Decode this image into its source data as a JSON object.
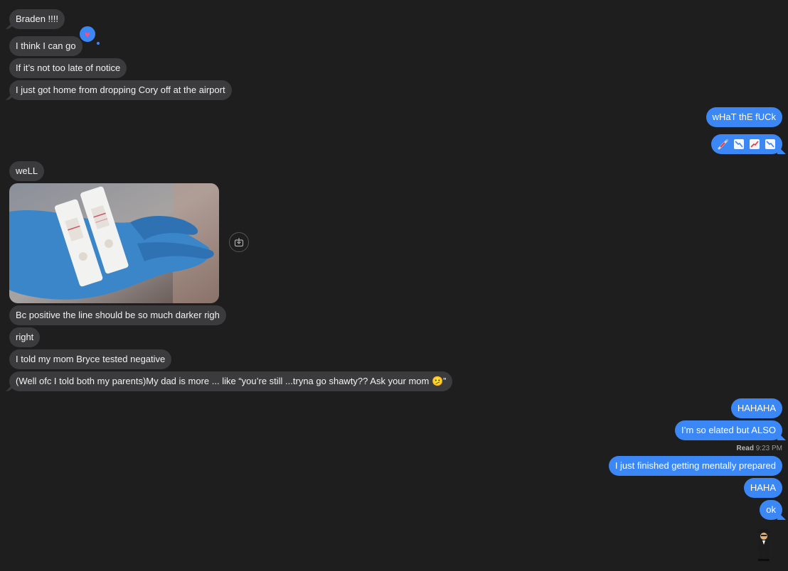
{
  "incoming_top": [
    {
      "text": "Braden !!!!"
    },
    {
      "text": "I think I can go"
    },
    {
      "text": "If it’s not too late of notice"
    },
    {
      "text": "I just got home from dropping Cory off at the airport"
    }
  ],
  "outgoing_top": [
    {
      "text": "wHaT thE fUCk"
    }
  ],
  "emoji_message": {
    "icons": [
      "syringe-emoji",
      "chart-decreasing-emoji",
      "chart-increasing-emoji",
      "chart-decreasing-emoji"
    ]
  },
  "incoming_mid": [
    {
      "text": "weLL"
    },
    {
      "text": "Bc positive the line should be so much darker righ"
    },
    {
      "text": "right"
    },
    {
      "text": "I told my mom Bryce tested negative"
    },
    {
      "text": "(Well ofc I told both my parents)My dad is more ... like “you’re still ...tryna go shawty?? Ask your mom 🫤”"
    }
  ],
  "outgoing_bottom": [
    {
      "text": "HAHAHA"
    },
    {
      "text": "I’m so elated but ALSO"
    },
    {
      "text": "I just finished getting mentally prepared"
    },
    {
      "text": "HAHA"
    },
    {
      "text": "ok"
    }
  ],
  "read_receipt": {
    "label": "Read",
    "time": "9:23 PM"
  },
  "tapback": {
    "icon": "heart-icon"
  },
  "colors": {
    "background": "#1e1e1f",
    "incoming": "#3b3b3d",
    "outgoing": "#3b87f6"
  }
}
